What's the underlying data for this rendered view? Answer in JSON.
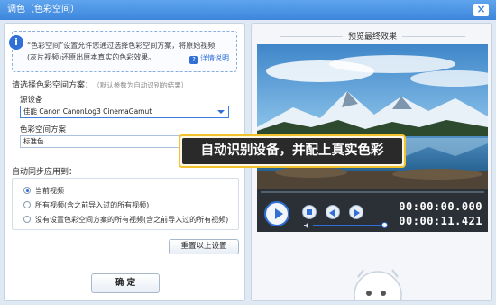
{
  "window": {
    "title": "调色（色彩空间）",
    "close_label": "×"
  },
  "info": {
    "icon": "info-icon",
    "text": "“色彩空间”设置允许您通过选择色彩空间方案，将原始视频(灰片视频)还原出原本真实的色彩效果。",
    "detail_link": "详情说明",
    "detail_icon": "help-book-icon"
  },
  "scheme": {
    "heading": "请选择色彩空间方案：",
    "hint": "（默认参数为自动识别的结果）",
    "source_label": "源设备",
    "source_value": "佳能 Canon CanonLog3 CinemaGamut",
    "space_label": "色彩空间方案",
    "space_value": "标准色"
  },
  "sync": {
    "heading": "自动同步应用到：",
    "options": [
      {
        "label": "当前视频",
        "checked": true
      },
      {
        "label": "所有视频(含之前导入过的所有视频)",
        "checked": false
      },
      {
        "label": "没有设置色彩空间方案的所有视频(含之前导入过的所有视频)",
        "checked": false
      }
    ],
    "reset_button": "重置以上设置"
  },
  "confirm_button": "确 定",
  "preview": {
    "title": "预览最终效果",
    "current_time": "00:00:00.000",
    "total_time": "00:00:11.421",
    "volume_icon": "speaker-icon"
  },
  "callout": {
    "text": "自动识别设备，并配上真实色彩"
  },
  "colors": {
    "accent": "#2f6fd6",
    "highlight": "#f2c12e",
    "titlebar": "#4a90e2"
  }
}
